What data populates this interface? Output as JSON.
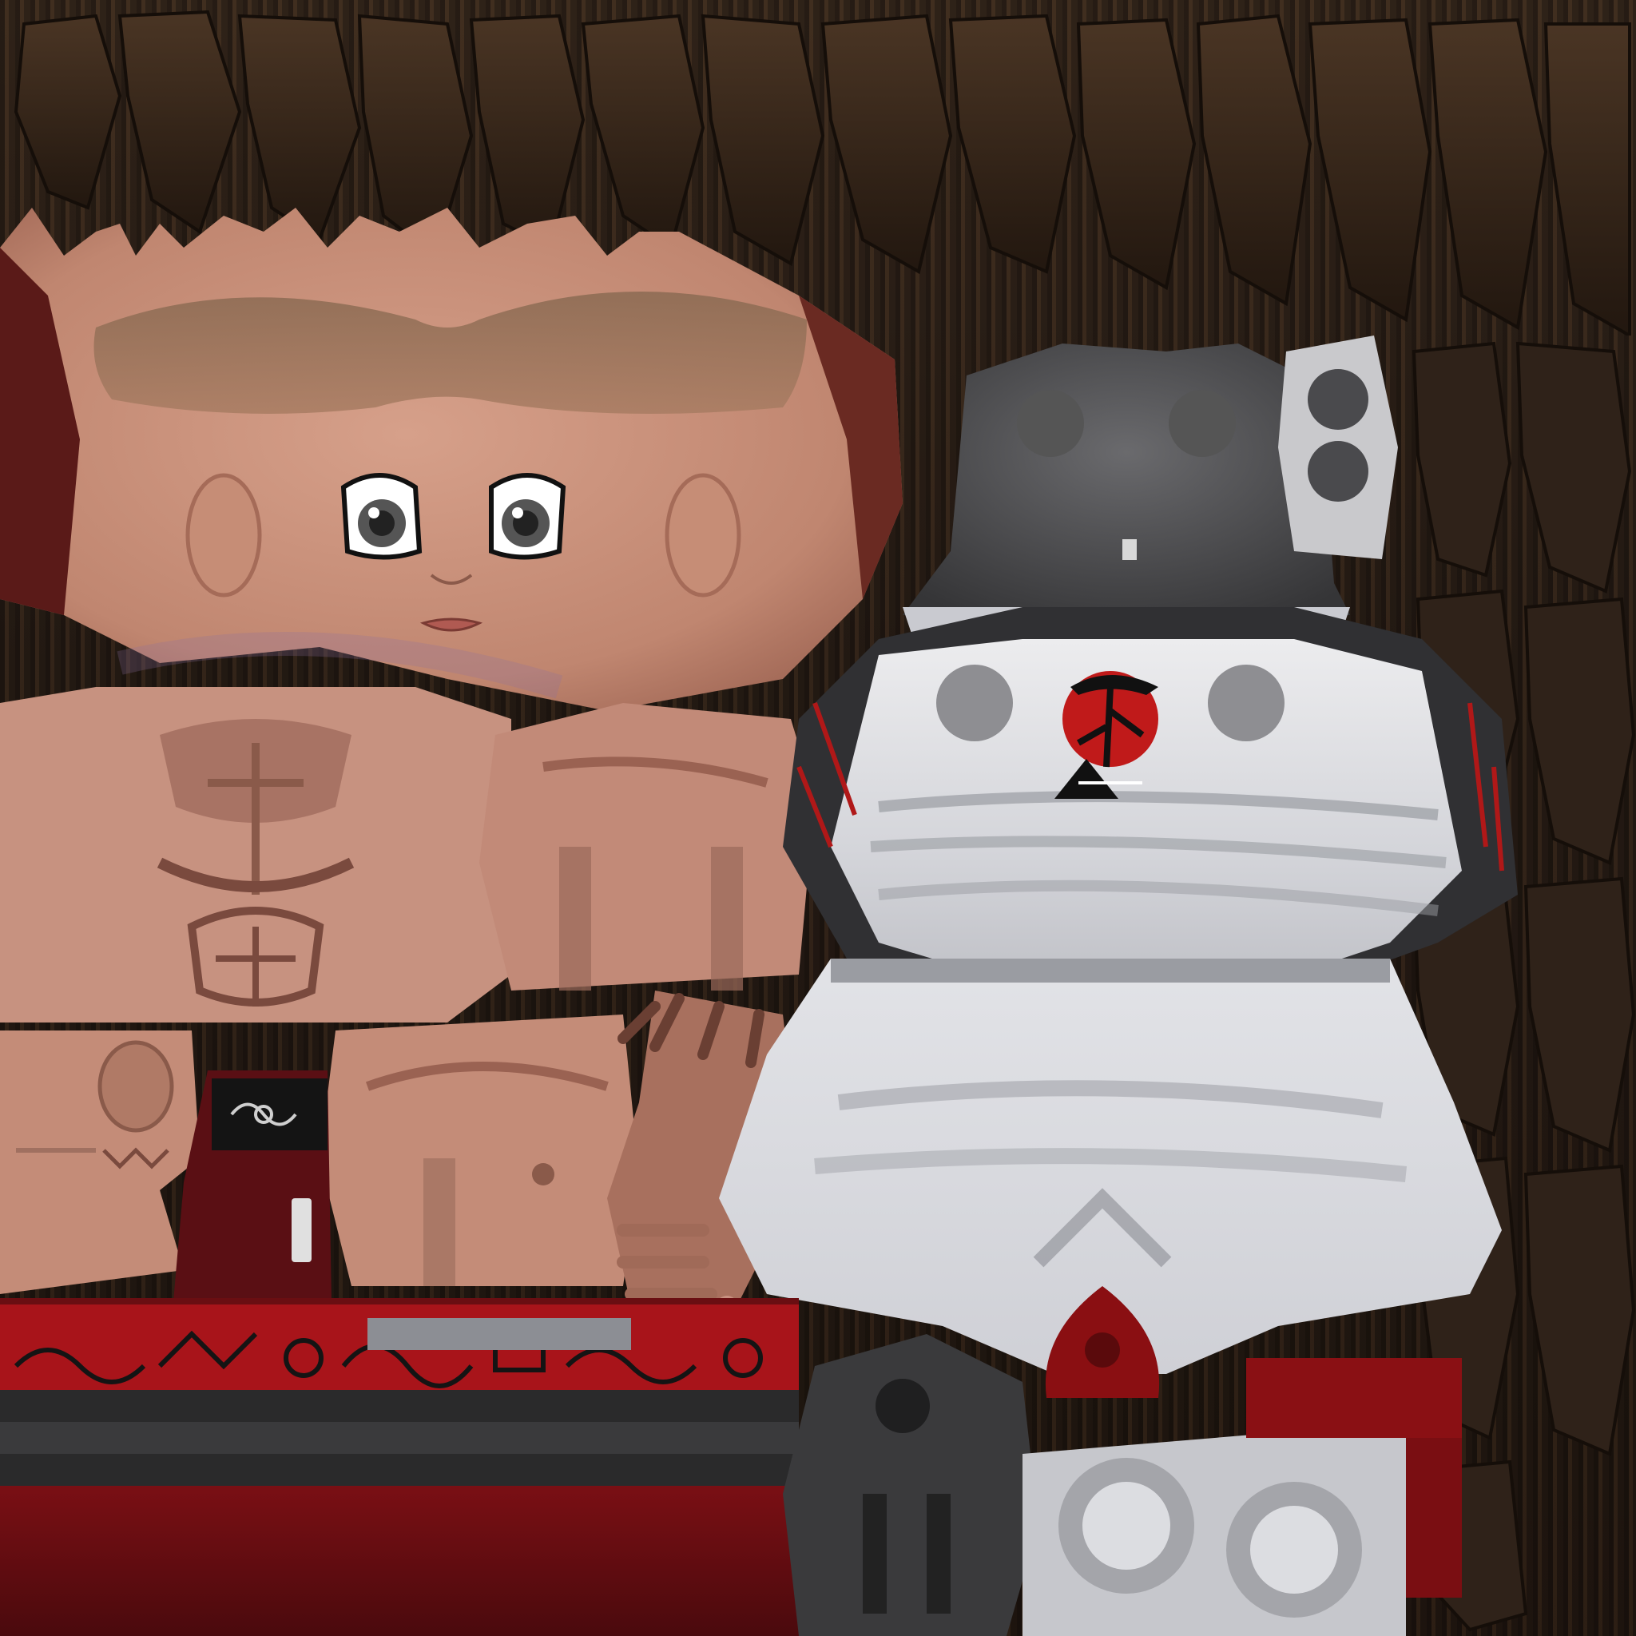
{
  "palette": {
    "hair_dark": "#2b1f17",
    "hair_light": "#6b4a30",
    "skin": "#d19a84",
    "skin_shadow": "#a8715f",
    "skin_dark": "#7a4a3e",
    "cloth_white": "#e8e8ea",
    "cloth_grey": "#9a9ca2",
    "cloth_dark": "#4a4a4d",
    "accent_red": "#b01818",
    "deep_red": "#5a0f12",
    "black": "#141414"
  },
  "islands": {
    "face": "face-island",
    "torso_front": "torso-front-island",
    "torso_back": "torso-back-island",
    "hands": "hand-island",
    "shirt": "shirt-island",
    "shorts": "shorts-island",
    "hood": "hood-island",
    "belt": "belt-island",
    "boots": "boot-island",
    "buttons": "button-island"
  },
  "motifs": {
    "shirt_print": "rising-sun-bonsai-icon",
    "belt_pattern": "tribal-pattern-icon",
    "wrist_band": "tribal-swirl-icon"
  }
}
